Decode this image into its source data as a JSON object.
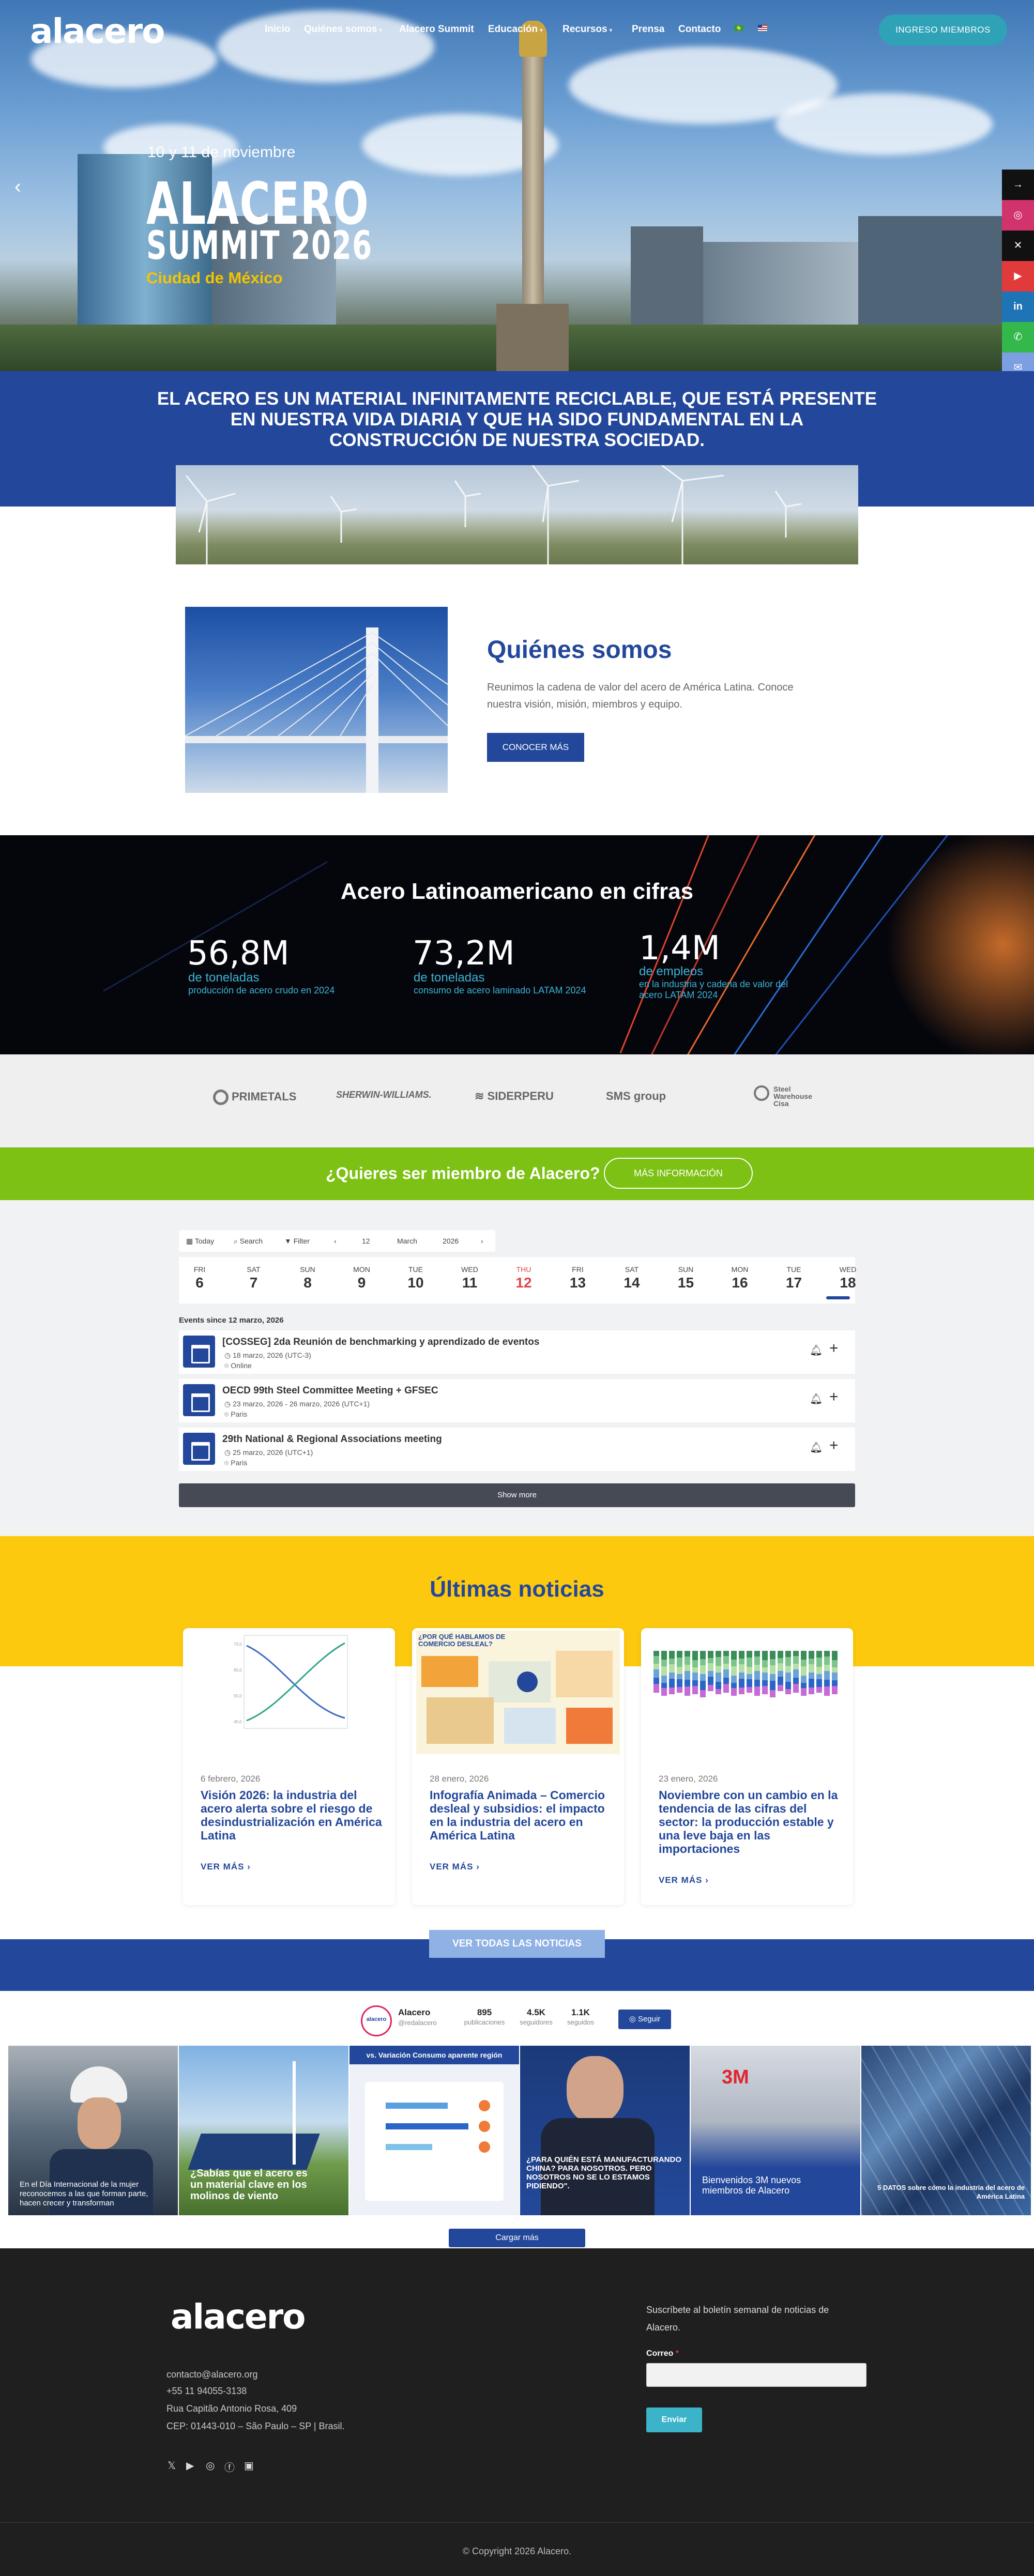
{
  "header": {
    "logo": "alacero",
    "nav": [
      "Inicio",
      "Quiénes somos",
      "Alacero Summit",
      "Educación",
      "Recursos",
      "Prensa",
      "Contacto"
    ],
    "login_button": "INGRESO MIEMBROS"
  },
  "hero": {
    "date": "10 y 11 de noviembre",
    "title_line1": "ALACERO",
    "title_line2": "SUMMIT 2026",
    "city": "Ciudad de México"
  },
  "social_sidebar": {
    "icons": [
      "share-arrow-icon",
      "instagram-icon",
      "x-icon",
      "youtube-icon",
      "linkedin-icon",
      "whatsapp-icon",
      "email-icon"
    ],
    "colors": [
      "#111111",
      "#d1336c",
      "#111111",
      "#e03a3a",
      "#1f74b5",
      "#35b84b",
      "#7b9fe0"
    ]
  },
  "statement": "EL ACERO ES UN MATERIAL INFINITAMENTE RECICLABLE, QUE ESTÁ PRESENTE EN NUESTRA VIDA DIARIA Y QUE HA SIDO FUNDAMENTAL EN LA CONSTRUCCIÓN DE NUESTRA SOCIEDAD.",
  "about": {
    "title": "Quiénes somos",
    "description": "Reunimos la cadena de valor del acero de América Latina. Conoce nuestra visión, misión, miembros y equipo.",
    "button": "CONOCER MÁS"
  },
  "figures": {
    "title": "Acero Latinoamericano en cifras",
    "items": [
      {
        "value": "56,8M",
        "unit": "de toneladas",
        "desc": "producción de acero crudo en 2024"
      },
      {
        "value": "73,2M",
        "unit": "de toneladas",
        "desc": "consumo de acero laminado LATAM 2024"
      },
      {
        "value": "1,4M",
        "unit": "de empleos",
        "desc": "en la industria y cadena de valor del acero LATAM 2024"
      }
    ]
  },
  "partners": [
    "PRIMETALS",
    "SHERWIN-WILLIAMS.",
    "SIDERPERU",
    "SMS group",
    "Steel Warehouse Cisa"
  ],
  "membership": {
    "text": "¿Quieres ser miembro de Alacero?",
    "button": "MÁS INFORMACIÓN"
  },
  "calendar": {
    "toolbar": {
      "today": "Today",
      "search": "Search",
      "filter": "Filter",
      "day": "12",
      "month": "March",
      "year": "2026"
    },
    "days": [
      {
        "name": "FRI",
        "num": "6"
      },
      {
        "name": "SAT",
        "num": "7"
      },
      {
        "name": "SUN",
        "num": "8"
      },
      {
        "name": "MON",
        "num": "9"
      },
      {
        "name": "TUE",
        "num": "10"
      },
      {
        "name": "WED",
        "num": "11"
      },
      {
        "name": "THU",
        "num": "12"
      },
      {
        "name": "FRI",
        "num": "13"
      },
      {
        "name": "SAT",
        "num": "14"
      },
      {
        "name": "SUN",
        "num": "15"
      },
      {
        "name": "MON",
        "num": "16"
      },
      {
        "name": "TUE",
        "num": "17"
      },
      {
        "name": "WED",
        "num": "18"
      }
    ],
    "events_since": "Events since 12 marzo, 2026",
    "events": [
      {
        "title": "[COSSEG] 2da Reunión de benchmarking y aprendizado de eventos",
        "date": "18 marzo, 2026 (UTC-3)",
        "place": "Online"
      },
      {
        "title": "OECD 99th Steel Committee Meeting + GFSEC",
        "date": "23 marzo, 2026 - 26 marzo, 2026 (UTC+1)",
        "place": "Paris"
      },
      {
        "title": "29th National & Regional Associations meeting",
        "date": "25 marzo, 2026 (UTC+1)",
        "place": "Paris"
      }
    ],
    "show_more": "Show more"
  },
  "news": {
    "title": "Últimas noticias",
    "cards": [
      {
        "date": "6 febrero, 2026",
        "title": "Visión 2026: la industria del acero alerta sobre el riesgo de desindustrialización en América Latina",
        "more": "VER MÁS"
      },
      {
        "date": "28 enero, 2026",
        "title": "Infografía Animada – Comercio desleal y subsidios: el impacto en la industria del acero en América Latina",
        "more": "VER MÁS",
        "image_text": "¿POR QUÉ HABLAMOS DE COMERCIO DESLEAL?"
      },
      {
        "date": "23 enero, 2026",
        "title": "Noviembre con un cambio en la tendencia de las cifras del sector: la producción estable y una leve baja en las importaciones",
        "more": "VER MÁS"
      }
    ],
    "all_button": "VER TODAS LAS NOTICIAS"
  },
  "instagram": {
    "name": "Alacero",
    "handle": "@redalacero",
    "stats": [
      {
        "n": "895",
        "l": "publicaciones"
      },
      {
        "n": "4.5K",
        "l": "seguidores"
      },
      {
        "n": "1.1K",
        "l": "seguidos"
      }
    ],
    "follow": "Seguir",
    "posts": [
      {
        "caption": "En el Día Internacional de la mujer reconocemos a las que forman parte, hacen crecer y transforman"
      },
      {
        "caption": "¿Sabías que el acero es un material clave en los molinos de viento"
      },
      {
        "caption": "vs. Variación Consumo aparente región"
      },
      {
        "caption": "¿PARA QUIÉN ESTÁ MANUFACTURANDO CHINA? PARA NOSOTROS. PERO NOSOTROS NO SE LO ESTAMOS PIDIENDO\"."
      },
      {
        "caption": "Bienvenidos 3M nuevos miembros de Alacero"
      },
      {
        "caption": "5 DATOS sobre cómo la industria del acero de América Latina"
      }
    ],
    "load_more": "Cargar más"
  },
  "footer": {
    "logo": "alacero",
    "email": "contacto@alacero.org",
    "phone": "+55 11 94055-3138",
    "address1": "Rua Capitão Antonio Rosa, 409",
    "address2": "CEP: 01443-010 – São Paulo – SP | Brasil.",
    "social": [
      "x-icon",
      "youtube-icon",
      "instagram-icon",
      "facebook-icon",
      "linkedin-icon"
    ],
    "newsletter": "Suscríbete al boletín semanal de noticias de Alacero.",
    "email_label": "Correo",
    "send": "Enviar",
    "copyright": "© Copyright 2026 Alacero."
  }
}
